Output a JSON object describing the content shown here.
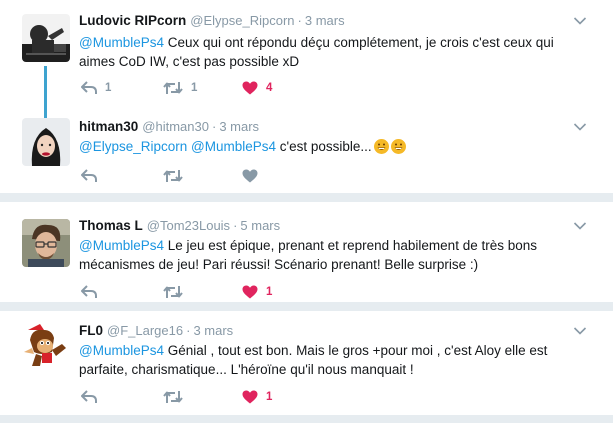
{
  "tweets": [
    {
      "fullname": "Ludovic RIPcorn",
      "handle": "@Elypse_Ripcorn",
      "time": "3 mars",
      "mention": "@MumblePs4",
      "text_line1": " Ceux qui ont répondu déçu complétement, je crois c'est ceux qui",
      "text_line2": "aimes CoD IW, c'est pas possible xD",
      "reply_count": "1",
      "retweet_count": "1",
      "like_count": "4",
      "liked": true
    },
    {
      "fullname": "hitman30",
      "handle": "@hitman30",
      "time": "3 mars",
      "mention1": "@Elypse_Ripcorn",
      "mention2": "@MumblePs4",
      "text": " c'est possible...",
      "reply_count": "",
      "retweet_count": "",
      "like_count": "",
      "liked": false
    },
    {
      "fullname": "Thomas L",
      "handle": "@Tom23Louis",
      "time": "5 mars",
      "mention": "@MumblePs4",
      "text_line1": " Le jeu est épique, prenant et reprend habilement de très bons",
      "text_line2": "mécanismes de jeu! Pari réussi! Scénario prenant! Belle surprise :)",
      "reply_count": "",
      "retweet_count": "",
      "like_count": "1",
      "liked": true
    },
    {
      "fullname": "FL0",
      "handle": "@F_Large16",
      "time": "3 mars",
      "mention": "@MumblePs4",
      "text_line1": " Génial , tout est bon. Mais le gros +pour moi , c'est Aloy elle est",
      "text_line2": "parfaite, charismatique... L'héroïne qu'il nous manquait !",
      "reply_count": "",
      "retweet_count": "",
      "like_count": "1",
      "liked": true
    }
  ],
  "separator": "·",
  "colors": {
    "link": "#1b95e0",
    "like": "#e0245e",
    "muted": "#8899a6",
    "thread_line": "#3ea3cf",
    "background": "#e6ecf0"
  },
  "icons": [
    "reply-icon",
    "retweet-icon",
    "heart-icon",
    "chevron-down-icon",
    "grinning-face-emoji"
  ]
}
